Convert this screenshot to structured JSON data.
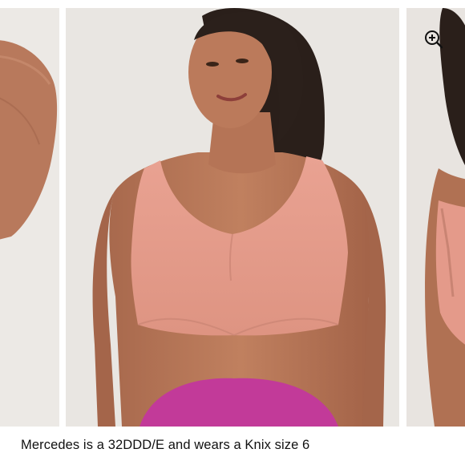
{
  "carousel": {
    "slides": [
      {
        "icon": "arm-photo-partial"
      },
      {
        "icon": "model-front-photo"
      },
      {
        "icon": "model-side-photo-partial"
      }
    ],
    "zoom_icon": "zoom-in-icon"
  },
  "caption": {
    "text": "Mercedes is a 32DDD/E and wears a Knix size 6"
  },
  "colors": {
    "bra": "#e49a8a",
    "bottoms": "#c23a99",
    "skin": "#b57659",
    "background": "#e9e5e1"
  }
}
